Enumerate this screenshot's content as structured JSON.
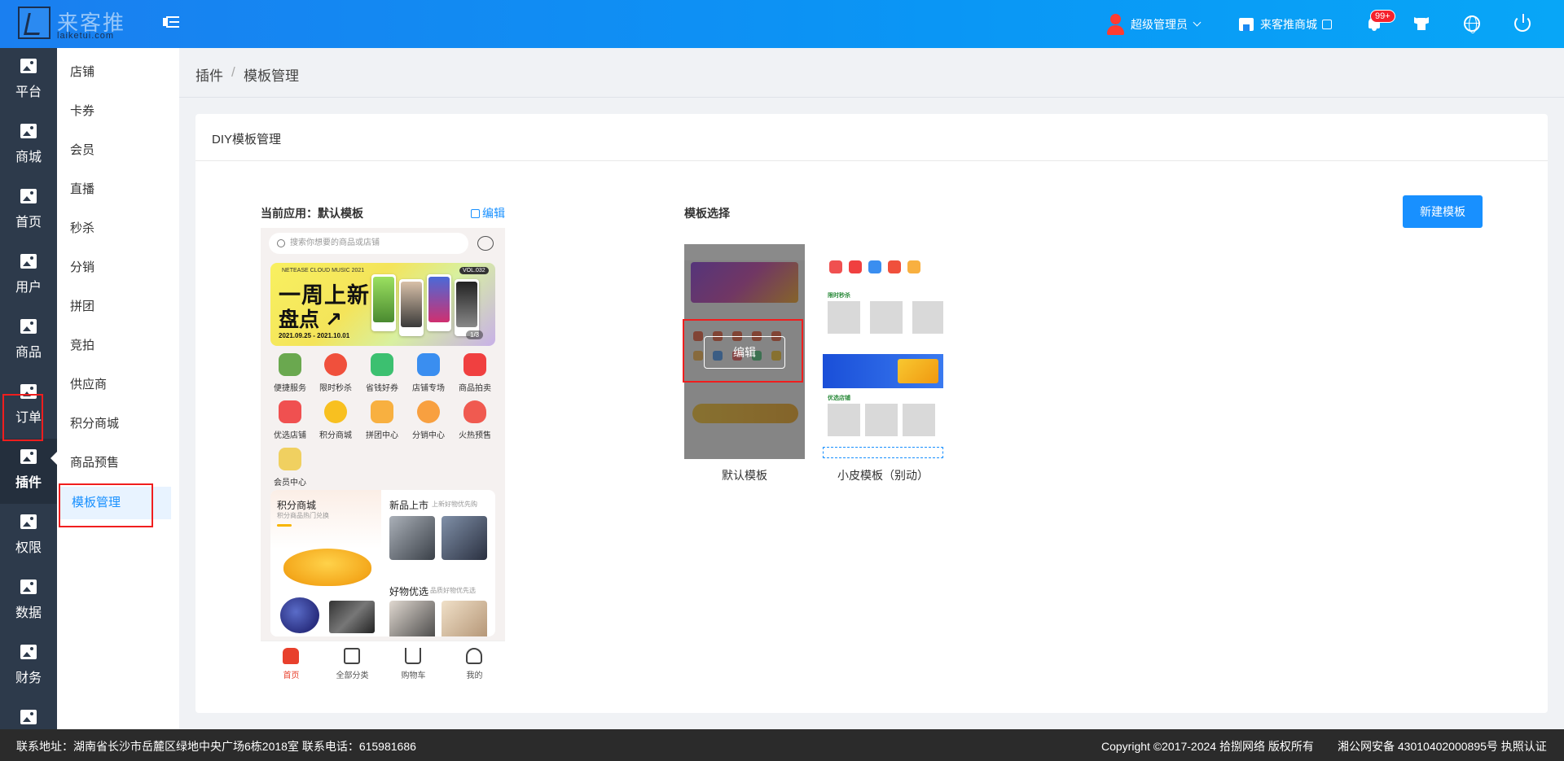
{
  "topbar": {
    "logo_cn": "来客推",
    "logo_en": "laiketui.com",
    "user_name": "超级管理员",
    "shop_link": "来客推商城",
    "notification_count": "99+"
  },
  "leftnav": {
    "items": [
      {
        "label": "平台"
      },
      {
        "label": "商城"
      },
      {
        "label": "首页"
      },
      {
        "label": "用户"
      },
      {
        "label": "商品"
      },
      {
        "label": "订单"
      },
      {
        "label": "插件"
      },
      {
        "label": "权限"
      },
      {
        "label": "数据"
      },
      {
        "label": "财务"
      }
    ],
    "active_index": 6
  },
  "submenu": {
    "items": [
      {
        "label": "店铺"
      },
      {
        "label": "卡券"
      },
      {
        "label": "会员"
      },
      {
        "label": "直播"
      },
      {
        "label": "秒杀"
      },
      {
        "label": "分销"
      },
      {
        "label": "拼团"
      },
      {
        "label": "竞拍"
      },
      {
        "label": "供应商"
      },
      {
        "label": "积分商城"
      },
      {
        "label": "商品预售"
      },
      {
        "label": "模板管理"
      }
    ],
    "active_index": 11
  },
  "breadcrumb": {
    "parent": "插件",
    "separator": "/",
    "current": "模板管理"
  },
  "card": {
    "title": "DIY模板管理",
    "current_label": "当前应用：默认模板",
    "edit_label": "编辑",
    "select_label": "模板选择",
    "new_button": "新建模板"
  },
  "preview": {
    "search_placeholder": "搜索你想要的商品或店铺",
    "banner": {
      "top_text": "NETEASE CLOUD MUSIC 2021",
      "vol": "VOL.032",
      "line1": "一周上新",
      "line2": "盘点 ↗",
      "date": "2021.09.25 - 2021.10.01",
      "page": "1/3"
    },
    "grid": [
      {
        "label": "便捷服务",
        "color": "#6aa84f"
      },
      {
        "label": "限时秒杀",
        "color": "#f0503c"
      },
      {
        "label": "省钱好券",
        "color": "#3cc070"
      },
      {
        "label": "店铺专场",
        "color": "#3a8ef0"
      },
      {
        "label": "商品拍卖",
        "color": "#f04040"
      },
      {
        "label": "优选店铺",
        "color": "#f05050"
      },
      {
        "label": "积分商城",
        "color": "#f8c020"
      },
      {
        "label": "拼团中心",
        "color": "#f8b040"
      },
      {
        "label": "分销中心",
        "color": "#f8a040"
      },
      {
        "label": "火热预售",
        "color": "#f05a50"
      },
      {
        "label": "会员中心",
        "color": "#f0d060"
      }
    ],
    "block": {
      "left_title": "积分商城",
      "left_sub": "积分商品热门兑换",
      "right_title1": "新品上市",
      "right_sub1": "上新好物优先购",
      "right_title2": "好物优选",
      "right_sub2": "品质好物优先选"
    },
    "tabs": [
      {
        "label": "首页"
      },
      {
        "label": "全部分类"
      },
      {
        "label": "购物车"
      },
      {
        "label": "我的"
      }
    ]
  },
  "templates": [
    {
      "label": "默认模板",
      "edit": "编辑"
    },
    {
      "label": "小皮模板（别动）",
      "section1": "限时秒杀",
      "section2": "优选店铺"
    }
  ],
  "footer": {
    "address": "联系地址：湖南省长沙市岳麓区绿地中央广场6栋2018室 联系电话：615981686",
    "copyright": "Copyright ©2017-2024 拾捌网络 版权所有",
    "icp": "湘公网安备 43010402000895号 执照认证"
  }
}
